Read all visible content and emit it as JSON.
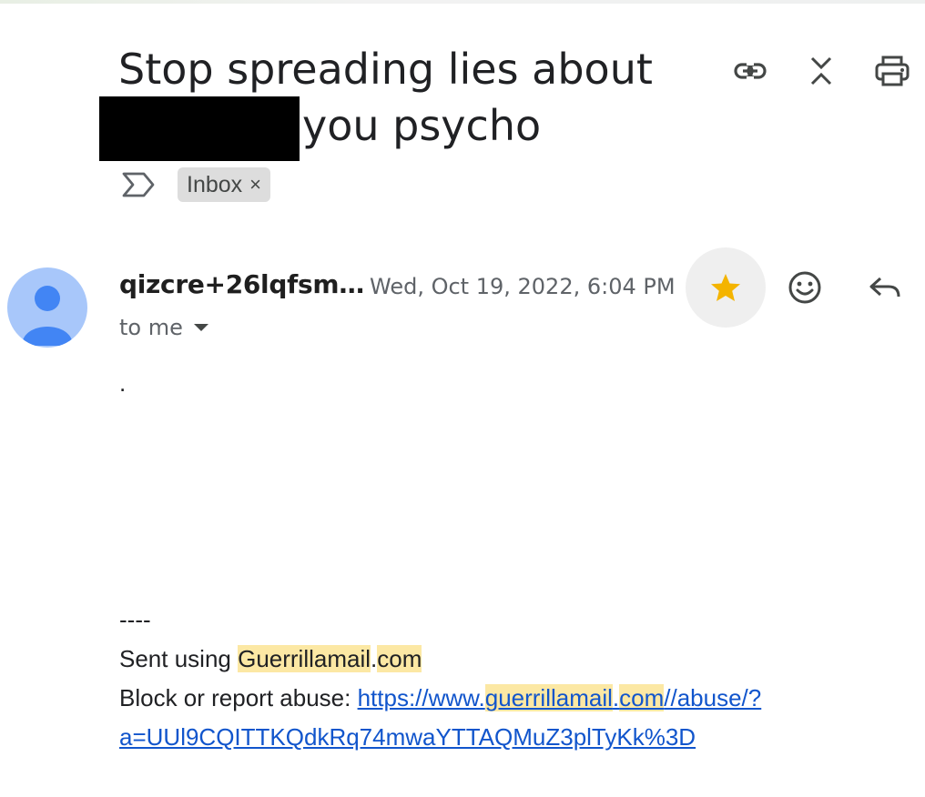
{
  "email": {
    "subject_line1": "Stop spreading lies about",
    "subject_line2": "you psycho",
    "label": "Inbox",
    "label_remove": "×",
    "sender": "qizcre+26lqfsm…",
    "date": "Wed, Oct 19, 2022, 6:04 PM",
    "recipient": "to me",
    "body": ".",
    "signature": {
      "separator": "----",
      "sent_prefix": "Sent using ",
      "sent_brand": "Guerrillamail",
      "sent_dot": ".",
      "sent_tld": "com",
      "abuse_prefix": "Block or report abuse: ",
      "link_part1": "https://www.",
      "link_part2": "guerrillamail",
      "link_part3": ".",
      "link_part4": "com",
      "link_part5": "//abuse/?",
      "link_line2": "a=UUl9CQITTKQdkRq74mwaYTTAQMuZ3plTyKk%3D"
    }
  },
  "icons": {
    "toolbar": [
      "link-icon",
      "collapse-all-icon",
      "print-icon"
    ],
    "important_marker": "label-important-icon",
    "star": "star-icon",
    "emoji": "emoji-reaction-icon",
    "reply": "reply-icon",
    "expand": "expand-details-icon"
  },
  "colors": {
    "star": "#f4b400",
    "avatar_bg": "#a8c7fa",
    "avatar_fg": "#4285f4",
    "highlight": "#fce8a4",
    "link": "#1155cc"
  }
}
